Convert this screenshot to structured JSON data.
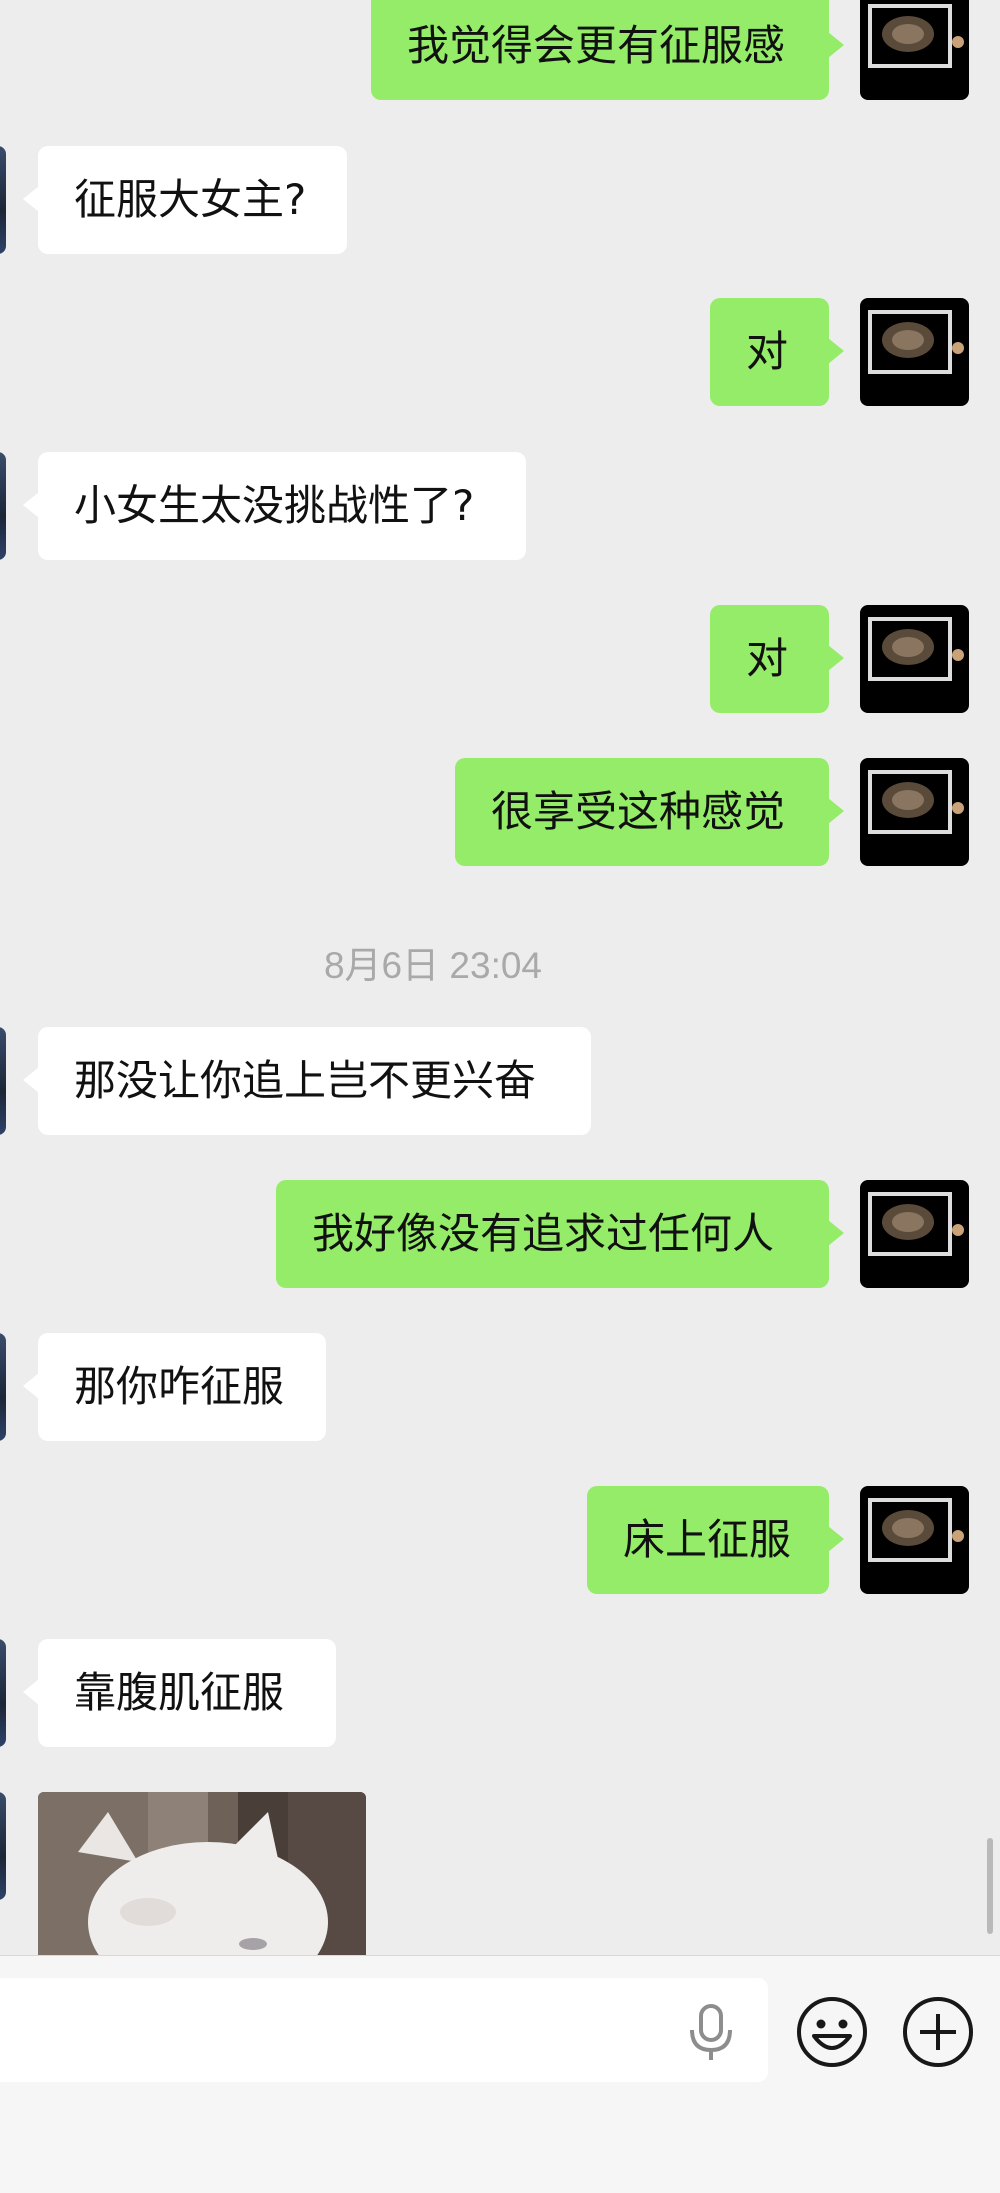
{
  "messages": [
    {
      "side": "sent",
      "text": "我觉得会更有征服感"
    },
    {
      "side": "recv",
      "text": "征服大女主?"
    },
    {
      "side": "sent",
      "text": "对"
    },
    {
      "side": "recv",
      "text": "小女生太没挑战性了?"
    },
    {
      "side": "sent",
      "text": "对"
    },
    {
      "side": "sent",
      "text": "很享受这种感觉"
    },
    {
      "side": "recv",
      "text": "那没让你追上岂不更兴奋"
    },
    {
      "side": "sent",
      "text": "我好像没有追求过任何人"
    },
    {
      "side": "recv",
      "text": "那你咋征服"
    },
    {
      "side": "sent",
      "text": "床上征服"
    },
    {
      "side": "recv",
      "text": "靠腹肌征服"
    }
  ],
  "timestamp": "8月6日 23:04",
  "icons": {
    "voice": "mic-icon",
    "emoji": "emoji-icon",
    "more": "plus-icon"
  },
  "colors": {
    "sent_bubble": "#95ec69",
    "recv_bubble": "#ffffff",
    "background": "#ededed"
  }
}
